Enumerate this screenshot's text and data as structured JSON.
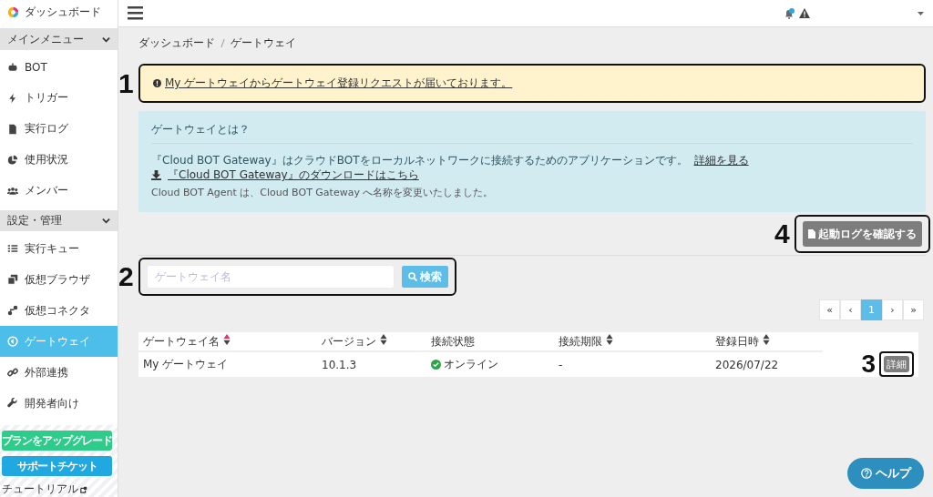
{
  "sidebar": {
    "brand": "ダッシュボード",
    "sections": [
      {
        "title": "メインメニュー",
        "expanded": true,
        "items": [
          {
            "label": "BOT",
            "selected": false
          },
          {
            "label": "トリガー",
            "selected": false
          },
          {
            "label": "実行ログ",
            "selected": false
          },
          {
            "label": "使用状況",
            "selected": false
          },
          {
            "label": "メンバー",
            "selected": false
          }
        ]
      },
      {
        "title": "設定・管理",
        "expanded": true,
        "items": [
          {
            "label": "実行キュー",
            "selected": false
          },
          {
            "label": "仮想ブラウザ",
            "selected": false
          },
          {
            "label": "仮想コネクタ",
            "selected": false
          },
          {
            "label": "ゲートウェイ",
            "selected": true
          },
          {
            "label": "外部連携",
            "selected": false
          },
          {
            "label": "開発者向け",
            "selected": false
          }
        ]
      }
    ],
    "buttons": [
      {
        "label": "プランをアップグレード",
        "color": "#2ecc8a"
      },
      {
        "label": "サポートチケット",
        "color": "#20a8e0"
      }
    ],
    "tutorial_link": "チュートリアル"
  },
  "topbar": {
    "notification_dot": true
  },
  "breadcrumb": [
    "ダッシュボード",
    "ゲートウェイ"
  ],
  "alert": {
    "callout": "1",
    "text": "My ゲートウェイからゲートウェイ登録リクエストが届いております。"
  },
  "info": {
    "title": "ゲートウェイとは？",
    "description": "『Cloud BOT Gateway』はクラウドBOTをローカルネットワークに接続するためのアプリケーションです。",
    "details_link": "詳細を見る",
    "download_link": "『Cloud BOT Gateway』のダウンロードはこちら",
    "note": "Cloud BOT Agent は、Cloud BOT Gateway へ名称を変更いたしました。"
  },
  "log_button": {
    "callout": "4",
    "label": "起動ログを確認する"
  },
  "search": {
    "callout": "2",
    "placeholder": "ゲートウェイ名",
    "button": "検索"
  },
  "pagination": [
    {
      "label": "«",
      "selected": false
    },
    {
      "label": "‹",
      "selected": false
    },
    {
      "label": "1",
      "selected": true
    },
    {
      "label": "›",
      "selected": false
    },
    {
      "label": "»",
      "selected": false
    }
  ],
  "table": {
    "columns": [
      {
        "label": "ゲートウェイ名",
        "sortable": true,
        "sorted": true
      },
      {
        "label": "バージョン",
        "sortable": true,
        "sorted": false
      },
      {
        "label": "接続状態",
        "sortable": false
      },
      {
        "label": "接続期限",
        "sortable": true,
        "sorted": false
      },
      {
        "label": "登録日時",
        "sortable": true,
        "sorted": false
      }
    ],
    "rows": [
      {
        "cells": [
          "My ゲートウェイ",
          "10.1.3",
          "オンライン",
          "-",
          "2026/07/22"
        ],
        "online": true,
        "detail_button": {
          "callout": "3",
          "label": "詳細"
        }
      }
    ]
  },
  "help_button": "ヘルプ"
}
